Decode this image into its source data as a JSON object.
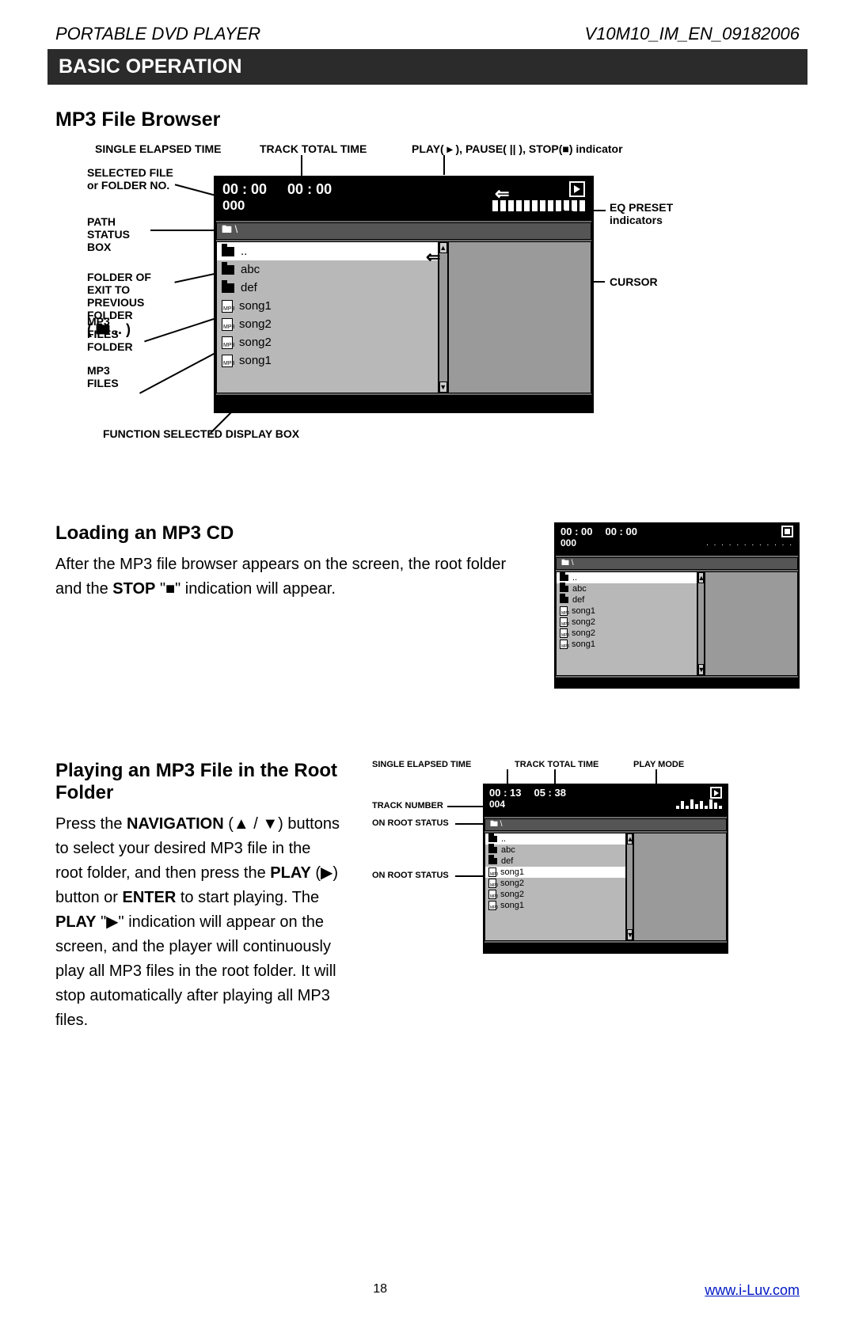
{
  "header": {
    "left": "PORTABLE DVD PLAYER",
    "right": "V10M10_IM_EN_09182006"
  },
  "section_title": "BASIC OPERATION",
  "h2_browser": "MP3 File Browser",
  "fig1": {
    "labels": {
      "single_elapsed": "SINGLE ELAPSED TIME",
      "track_total": "TRACK TOTAL TIME",
      "indicator": "PLAY( ▸ ), PAUSE( || ), STOP(■) indicator",
      "selected": "SELECTED FILE\nor FOLDER NO.",
      "path_status": "PATH\nSTATUS\nBOX",
      "exit_prev": "FOLDER OF\nEXIT TO\nPREVIOUS\nFOLDER",
      "exit_icon": "( 🖿 .. )",
      "mp3_folder": "MP3\nFILES\nFOLDER",
      "mp3_files": "MP3\nFILES",
      "eq": "EQ PRESET\nindicators",
      "cursor": "CURSOR",
      "func_box": "FUNCTION SELECTED DISPLAY BOX"
    },
    "win": {
      "time1": "00 : 00",
      "time2": "00 : 00",
      "num": "000",
      "path": "🖿 \\",
      "rows": [
        {
          "icon": "folder",
          "txt": ".."
        },
        {
          "icon": "folder",
          "txt": "abc"
        },
        {
          "icon": "folder",
          "txt": "def"
        },
        {
          "icon": "file",
          "txt": "song1"
        },
        {
          "icon": "file",
          "txt": "song2"
        },
        {
          "icon": "file",
          "txt": "song2"
        },
        {
          "icon": "file",
          "txt": "song1"
        }
      ]
    }
  },
  "sec_loading": {
    "title": "Loading an MP3 CD",
    "text_a": "After the MP3 file browser appears on the screen, the root folder and the ",
    "text_b": "STOP",
    "text_c": " \"■\" indication will appear."
  },
  "fig2": {
    "time1": "00 : 00",
    "time2": "00 : 00",
    "num": "000",
    "path": "🖿 \\",
    "mode": "stop",
    "rows": [
      {
        "icon": "folder",
        "txt": ".."
      },
      {
        "icon": "folder",
        "txt": "abc"
      },
      {
        "icon": "folder",
        "txt": "def"
      },
      {
        "icon": "file",
        "txt": "song1"
      },
      {
        "icon": "file",
        "txt": "song2"
      },
      {
        "icon": "file",
        "txt": "song2"
      },
      {
        "icon": "file",
        "txt": "song1"
      }
    ]
  },
  "sec_playing": {
    "title": "Playing an MP3 File in the Root Folder",
    "p1a": "Press the ",
    "p1b": "NAVIGATION",
    "p1c": " (▲ / ▼) buttons to select your desired MP3 file in the root folder, and then press the ",
    "p1d": "PLAY",
    "p1e": " (▶) button or ",
    "p1f": "ENTER",
    "p1g": " to start playing. The ",
    "p1h": "PLAY",
    "p1i": " \"▶\" indication will appear on the screen, and the player will continuously play all MP3 files in the root folder. It will stop automatically after playing all MP3 files."
  },
  "fig3": {
    "labels": {
      "single_elapsed": "SINGLE ELAPSED TIME",
      "track_total": "TRACK TOTAL TIME",
      "play_mode": "PLAY MODE",
      "track_num": "TRACK NUMBER",
      "on_root_1": "ON ROOT STATUS",
      "on_root_2": "ON ROOT STATUS"
    },
    "win": {
      "time1": "00 : 13",
      "time2": "05 : 38",
      "num": "004",
      "path": "🖿 \\",
      "mode": "play",
      "rows": [
        {
          "icon": "folder",
          "txt": ".."
        },
        {
          "icon": "folder",
          "txt": "abc"
        },
        {
          "icon": "folder",
          "txt": "def"
        },
        {
          "icon": "file",
          "txt": "song1",
          "sel": true
        },
        {
          "icon": "file",
          "txt": "song2"
        },
        {
          "icon": "file",
          "txt": "song2"
        },
        {
          "icon": "file",
          "txt": "song1"
        }
      ]
    }
  },
  "footer": {
    "page": "18",
    "url_text": "www.i-Luv.com"
  }
}
